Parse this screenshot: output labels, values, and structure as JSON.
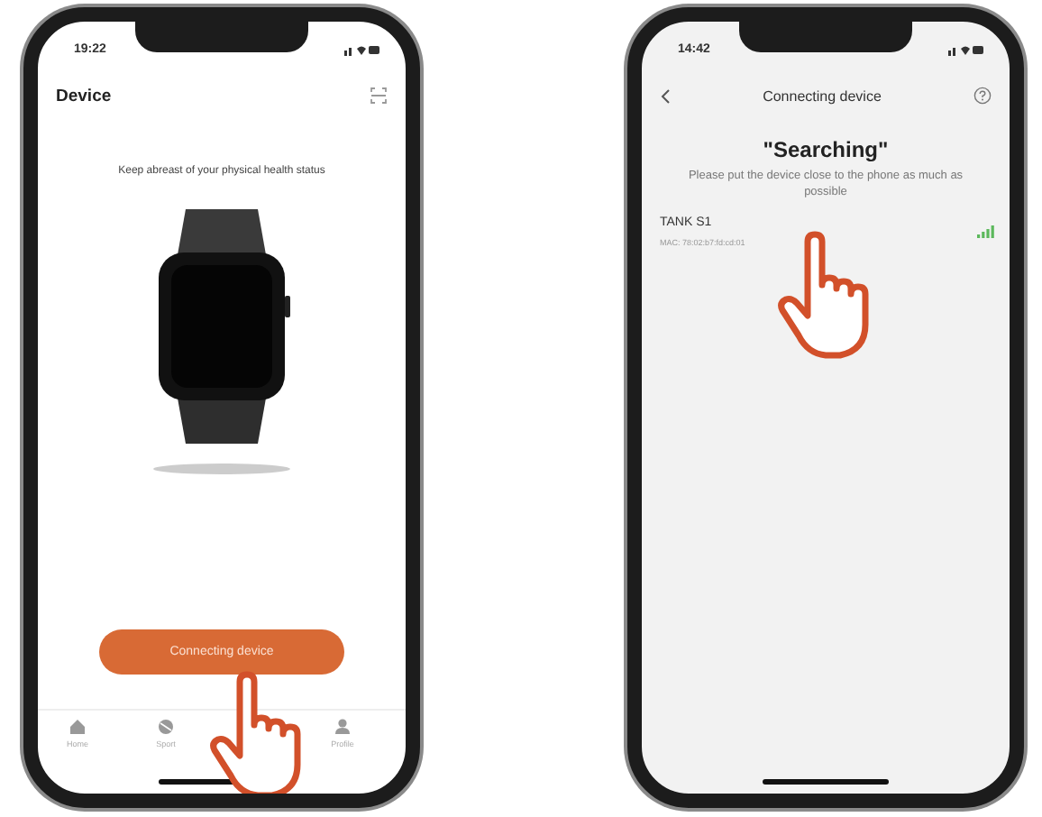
{
  "screens": [
    {
      "kind": "device",
      "status_time": "19:22",
      "title": "Device",
      "subtitle": "Keep abreast of your physical health status",
      "button": "Connecting device",
      "tabs": [
        {
          "label": "Home"
        },
        {
          "label": "Sport"
        },
        {
          "label": "Profile"
        }
      ]
    },
    {
      "kind": "connecting",
      "status_time": "14:42",
      "title": "Connecting device",
      "heading": "\"Searching\"",
      "message": "Please put the device close to the phone as much as possible",
      "devices": [
        {
          "name": "TANK S1",
          "mac": "MAC: 78:02:b7:fd:cd:01"
        }
      ]
    }
  ]
}
